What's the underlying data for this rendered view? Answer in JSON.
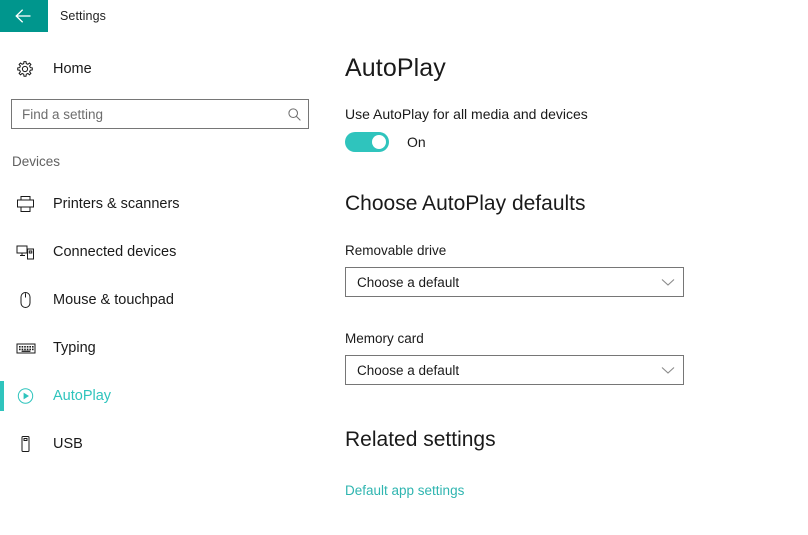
{
  "titlebar": {
    "back_icon": "arrow-left-icon",
    "title": "Settings"
  },
  "sidebar": {
    "home": {
      "label": "Home",
      "icon": "gear-icon"
    },
    "search": {
      "placeholder": "Find a setting",
      "value": "",
      "icon": "search-icon"
    },
    "section_header": "Devices",
    "items": [
      {
        "label": "Printers & scanners",
        "icon": "printer-icon",
        "selected": false
      },
      {
        "label": "Connected devices",
        "icon": "connected-devices-icon",
        "selected": false
      },
      {
        "label": "Mouse & touchpad",
        "icon": "mouse-icon",
        "selected": false
      },
      {
        "label": "Typing",
        "icon": "keyboard-icon",
        "selected": false
      },
      {
        "label": "AutoPlay",
        "icon": "autoplay-icon",
        "selected": true
      },
      {
        "label": "USB",
        "icon": "usb-icon",
        "selected": false
      }
    ]
  },
  "main": {
    "page_title": "AutoPlay",
    "toggle": {
      "caption": "Use AutoPlay for all media and devices",
      "state_label": "On",
      "checked": true
    },
    "defaults_section": {
      "title": "Choose AutoPlay defaults",
      "fields": [
        {
          "label": "Removable drive",
          "value": "Choose a default"
        },
        {
          "label": "Memory card",
          "value": "Choose a default"
        }
      ]
    },
    "related_section": {
      "title": "Related settings",
      "link": "Default app settings"
    }
  },
  "colors": {
    "accent": "#2fc4bd",
    "titlebar_back": "#00968d",
    "link": "#2fb5b0",
    "border": "#767676"
  }
}
